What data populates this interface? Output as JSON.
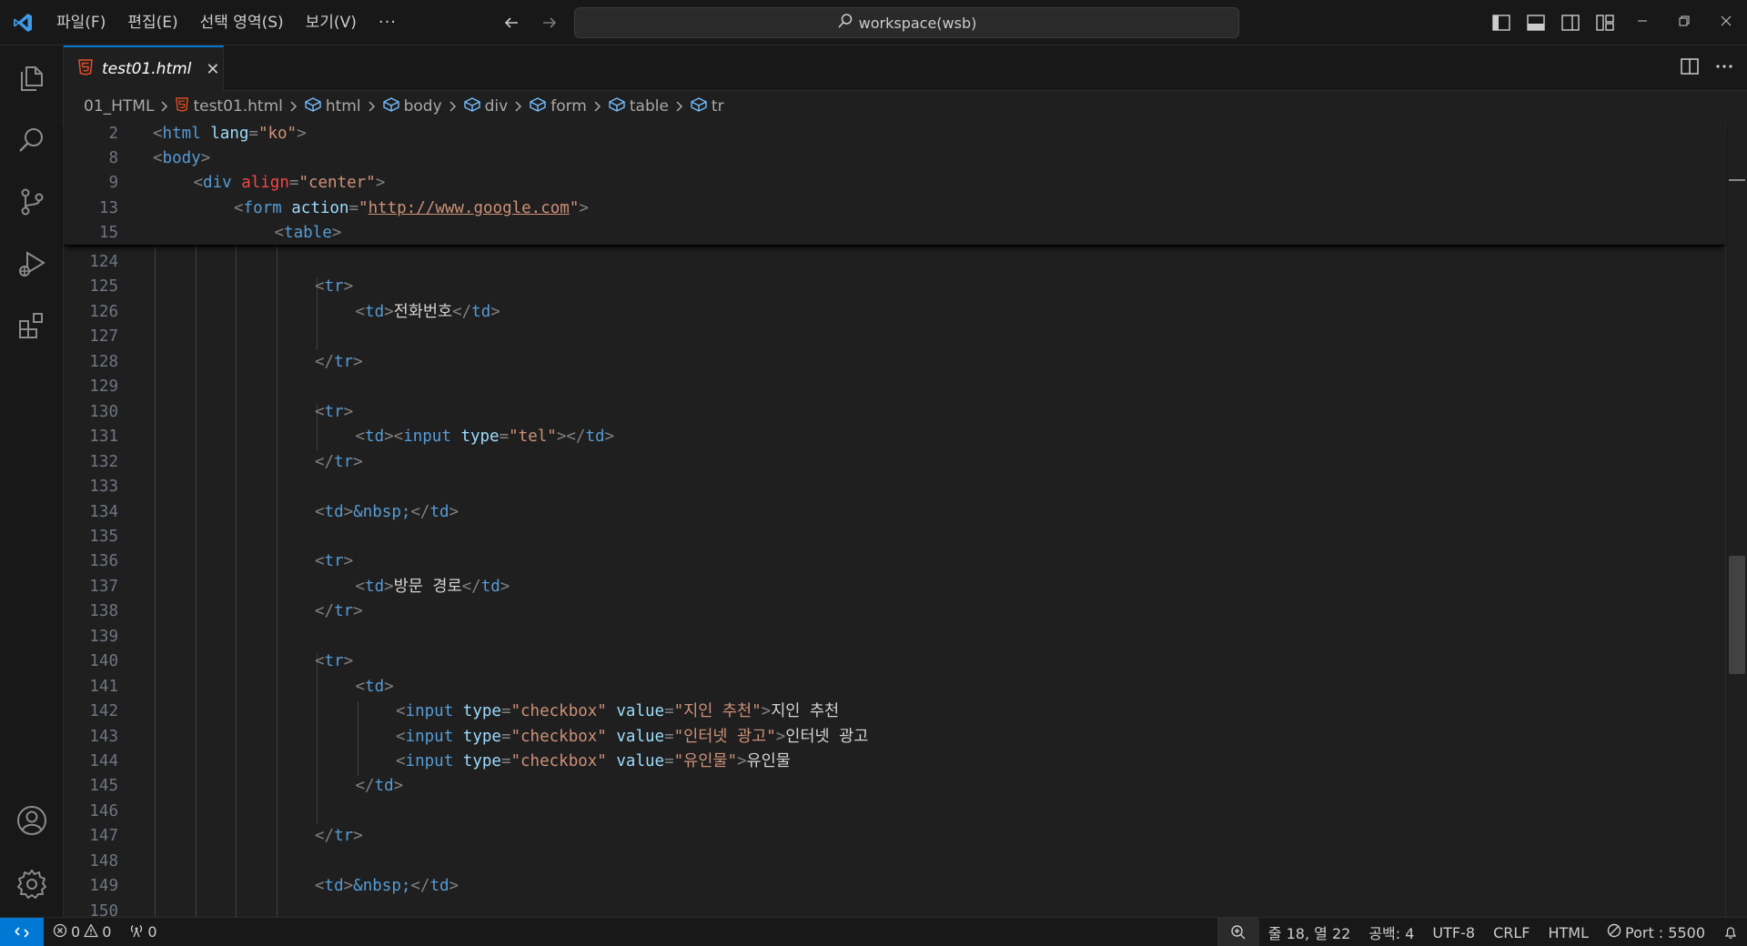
{
  "menu": {
    "items": [
      "파일(F)",
      "편집(E)",
      "선택 영역(S)",
      "보기(V)"
    ],
    "more": "···"
  },
  "search": {
    "label": "workspace(wsb)"
  },
  "tab": {
    "label": "test01.html",
    "close": "✕"
  },
  "breadcrumb": [
    "01_HTML",
    "test01.html",
    "html",
    "body",
    "div",
    "form",
    "table",
    "tr"
  ],
  "sticky_lines": [
    {
      "num": "2",
      "indent": 0,
      "tokens": [
        [
          "br",
          "<"
        ],
        [
          "tag",
          "html"
        ],
        [
          "sp",
          " "
        ],
        [
          "attr",
          "lang"
        ],
        [
          "br",
          "="
        ],
        [
          "val",
          "\"ko\""
        ],
        [
          "br",
          ">"
        ]
      ]
    },
    {
      "num": "8",
      "indent": 0,
      "tokens": [
        [
          "br",
          "<"
        ],
        [
          "tag",
          "body"
        ],
        [
          "br",
          ">"
        ]
      ]
    },
    {
      "num": "9",
      "indent": 1,
      "tokens": [
        [
          "br",
          "<"
        ],
        [
          "tag",
          "div"
        ],
        [
          "sp",
          " "
        ],
        [
          "red",
          "align"
        ],
        [
          "br",
          "="
        ],
        [
          "val",
          "\"center\""
        ],
        [
          "br",
          ">"
        ]
      ]
    },
    {
      "num": "13",
      "indent": 2,
      "tokens": [
        [
          "br",
          "<"
        ],
        [
          "tag",
          "form"
        ],
        [
          "sp",
          " "
        ],
        [
          "attr",
          "action"
        ],
        [
          "br",
          "="
        ],
        [
          "val",
          "\""
        ],
        [
          "url",
          "http://www.google.com"
        ],
        [
          "val",
          "\""
        ],
        [
          "br",
          ">"
        ]
      ]
    },
    {
      "num": "15",
      "indent": 3,
      "tokens": [
        [
          "br",
          "<"
        ],
        [
          "tag",
          "table"
        ],
        [
          "br",
          ">"
        ]
      ]
    }
  ],
  "code_lines": [
    {
      "num": "124",
      "indent": 4,
      "tokens": []
    },
    {
      "num": "125",
      "indent": 4,
      "tokens": [
        [
          "br",
          "<"
        ],
        [
          "tag",
          "tr"
        ],
        [
          "br",
          ">"
        ]
      ]
    },
    {
      "num": "126",
      "indent": 5,
      "tokens": [
        [
          "br",
          "<"
        ],
        [
          "tag",
          "td"
        ],
        [
          "br",
          ">"
        ],
        [
          "text",
          "전화번호"
        ],
        [
          "br",
          "</"
        ],
        [
          "tag",
          "td"
        ],
        [
          "br",
          ">"
        ]
      ]
    },
    {
      "num": "127",
      "indent": 5,
      "tokens": []
    },
    {
      "num": "128",
      "indent": 4,
      "tokens": [
        [
          "br",
          "</"
        ],
        [
          "tag",
          "tr"
        ],
        [
          "br",
          ">"
        ]
      ]
    },
    {
      "num": "129",
      "indent": 4,
      "tokens": []
    },
    {
      "num": "130",
      "indent": 4,
      "tokens": [
        [
          "br",
          "<"
        ],
        [
          "tag",
          "tr"
        ],
        [
          "br",
          ">"
        ]
      ]
    },
    {
      "num": "131",
      "indent": 5,
      "tokens": [
        [
          "br",
          "<"
        ],
        [
          "tag",
          "td"
        ],
        [
          "br",
          "><"
        ],
        [
          "tag",
          "input"
        ],
        [
          "sp",
          " "
        ],
        [
          "attr",
          "type"
        ],
        [
          "br",
          "="
        ],
        [
          "val",
          "\"tel\""
        ],
        [
          "br",
          "></"
        ],
        [
          "tag",
          "td"
        ],
        [
          "br",
          ">"
        ]
      ]
    },
    {
      "num": "132",
      "indent": 4,
      "tokens": [
        [
          "br",
          "</"
        ],
        [
          "tag",
          "tr"
        ],
        [
          "br",
          ">"
        ]
      ]
    },
    {
      "num": "133",
      "indent": 4,
      "tokens": []
    },
    {
      "num": "134",
      "indent": 4,
      "tokens": [
        [
          "br",
          "<"
        ],
        [
          "tag",
          "td"
        ],
        [
          "br",
          ">"
        ],
        [
          "ent",
          "&nbsp;"
        ],
        [
          "br",
          "</"
        ],
        [
          "tag",
          "td"
        ],
        [
          "br",
          ">"
        ]
      ]
    },
    {
      "num": "135",
      "indent": 4,
      "tokens": []
    },
    {
      "num": "136",
      "indent": 4,
      "tokens": [
        [
          "br",
          "<"
        ],
        [
          "tag",
          "tr"
        ],
        [
          "br",
          ">"
        ]
      ]
    },
    {
      "num": "137",
      "indent": 5,
      "tokens": [
        [
          "br",
          "<"
        ],
        [
          "tag",
          "td"
        ],
        [
          "br",
          ">"
        ],
        [
          "text",
          "방문 경로"
        ],
        [
          "br",
          "</"
        ],
        [
          "tag",
          "td"
        ],
        [
          "br",
          ">"
        ]
      ]
    },
    {
      "num": "138",
      "indent": 4,
      "tokens": [
        [
          "br",
          "</"
        ],
        [
          "tag",
          "tr"
        ],
        [
          "br",
          ">"
        ]
      ]
    },
    {
      "num": "139",
      "indent": 4,
      "tokens": []
    },
    {
      "num": "140",
      "indent": 4,
      "tokens": [
        [
          "br",
          "<"
        ],
        [
          "tag",
          "tr"
        ],
        [
          "br",
          ">"
        ]
      ]
    },
    {
      "num": "141",
      "indent": 5,
      "tokens": [
        [
          "br",
          "<"
        ],
        [
          "tag",
          "td"
        ],
        [
          "br",
          ">"
        ]
      ]
    },
    {
      "num": "142",
      "indent": 6,
      "tokens": [
        [
          "br",
          "<"
        ],
        [
          "tag",
          "input"
        ],
        [
          "sp",
          " "
        ],
        [
          "attr",
          "type"
        ],
        [
          "br",
          "="
        ],
        [
          "val",
          "\"checkbox\""
        ],
        [
          "sp",
          " "
        ],
        [
          "attr",
          "value"
        ],
        [
          "br",
          "="
        ],
        [
          "val",
          "\"지인 추천\""
        ],
        [
          "br",
          ">"
        ],
        [
          "text",
          "지인 추천"
        ]
      ]
    },
    {
      "num": "143",
      "indent": 6,
      "tokens": [
        [
          "br",
          "<"
        ],
        [
          "tag",
          "input"
        ],
        [
          "sp",
          " "
        ],
        [
          "attr",
          "type"
        ],
        [
          "br",
          "="
        ],
        [
          "val",
          "\"checkbox\""
        ],
        [
          "sp",
          " "
        ],
        [
          "attr",
          "value"
        ],
        [
          "br",
          "="
        ],
        [
          "val",
          "\"인터넷 광고\""
        ],
        [
          "br",
          ">"
        ],
        [
          "text",
          "인터넷 광고"
        ]
      ]
    },
    {
      "num": "144",
      "indent": 6,
      "tokens": [
        [
          "br",
          "<"
        ],
        [
          "tag",
          "input"
        ],
        [
          "sp",
          " "
        ],
        [
          "attr",
          "type"
        ],
        [
          "br",
          "="
        ],
        [
          "val",
          "\"checkbox\""
        ],
        [
          "sp",
          " "
        ],
        [
          "attr",
          "value"
        ],
        [
          "br",
          "="
        ],
        [
          "val",
          "\"유인물\""
        ],
        [
          "br",
          ">"
        ],
        [
          "text",
          "유인물"
        ]
      ]
    },
    {
      "num": "145",
      "indent": 5,
      "tokens": [
        [
          "br",
          "</"
        ],
        [
          "tag",
          "td"
        ],
        [
          "br",
          ">"
        ]
      ]
    },
    {
      "num": "146",
      "indent": 5,
      "tokens": []
    },
    {
      "num": "147",
      "indent": 4,
      "tokens": [
        [
          "br",
          "</"
        ],
        [
          "tag",
          "tr"
        ],
        [
          "br",
          ">"
        ]
      ]
    },
    {
      "num": "148",
      "indent": 4,
      "tokens": []
    },
    {
      "num": "149",
      "indent": 4,
      "tokens": [
        [
          "br",
          "<"
        ],
        [
          "tag",
          "td"
        ],
        [
          "br",
          ">"
        ],
        [
          "ent",
          "&nbsp;"
        ],
        [
          "br",
          "</"
        ],
        [
          "tag",
          "td"
        ],
        [
          "br",
          ">"
        ]
      ]
    },
    {
      "num": "150",
      "indent": 4,
      "tokens": []
    }
  ],
  "status": {
    "errors": "0",
    "warnings": "0",
    "ports": "0",
    "cursor": "줄 18, 열 22",
    "spaces": "공백: 4",
    "encoding": "UTF-8",
    "eol": "CRLF",
    "language": "HTML",
    "port": "Port : 5500"
  },
  "colors": {
    "accent": "#0078d4",
    "html_icon": "#e44d26"
  }
}
